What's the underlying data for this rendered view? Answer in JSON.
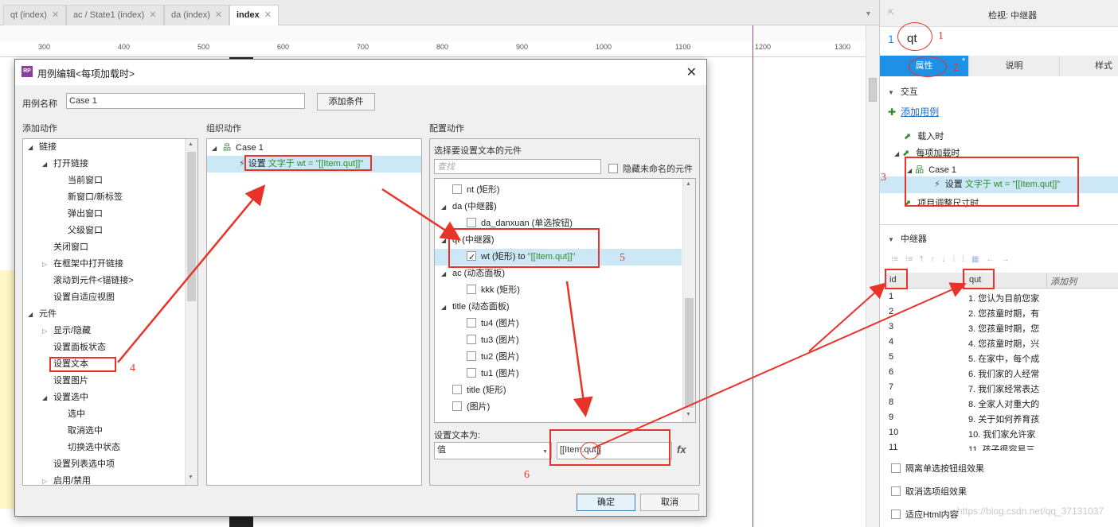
{
  "tabs": [
    {
      "label": "qt (index)"
    },
    {
      "label": "ac / State1 (index)"
    },
    {
      "label": "da (index)"
    },
    {
      "label": "index"
    }
  ],
  "ruler": [
    "300",
    "400",
    "500",
    "600",
    "700",
    "800",
    "900",
    "1000",
    "1100",
    "1200",
    "1300"
  ],
  "dialog": {
    "title": "用例编辑<每项加载时>",
    "case_name_label": "用例名称",
    "case_name_value": "Case 1",
    "add_condition": "添加条件",
    "col1_title": "添加动作",
    "col2_title": "组织动作",
    "col3_title": "配置动作",
    "actions": [
      {
        "label": "链接",
        "level": 0,
        "arrow": "down"
      },
      {
        "label": "打开链接",
        "level": 1,
        "arrow": "down"
      },
      {
        "label": "当前窗口",
        "level": 2,
        "arrow": ""
      },
      {
        "label": "新窗口/新标签",
        "level": 2,
        "arrow": ""
      },
      {
        "label": "弹出窗口",
        "level": 2,
        "arrow": ""
      },
      {
        "label": "父级窗口",
        "level": 2,
        "arrow": ""
      },
      {
        "label": "关闭窗口",
        "level": 1,
        "arrow": ""
      },
      {
        "label": "在框架中打开链接",
        "level": 1,
        "arrow": "right"
      },
      {
        "label": "滚动到元件<锚链接>",
        "level": 1,
        "arrow": ""
      },
      {
        "label": "设置自适应视图",
        "level": 1,
        "arrow": ""
      },
      {
        "label": "元件",
        "level": 0,
        "arrow": "down"
      },
      {
        "label": "显示/隐藏",
        "level": 1,
        "arrow": "right"
      },
      {
        "label": "设置面板状态",
        "level": 1,
        "arrow": ""
      },
      {
        "label": "设置文本",
        "level": 1,
        "arrow": ""
      },
      {
        "label": "设置图片",
        "level": 1,
        "arrow": ""
      },
      {
        "label": "设置选中",
        "level": 1,
        "arrow": "down"
      },
      {
        "label": "选中",
        "level": 2,
        "arrow": ""
      },
      {
        "label": "取消选中",
        "level": 2,
        "arrow": ""
      },
      {
        "label": "切换选中状态",
        "level": 2,
        "arrow": ""
      },
      {
        "label": "设置列表选中项",
        "level": 1,
        "arrow": ""
      },
      {
        "label": "启用/禁用",
        "level": 1,
        "arrow": "right"
      }
    ],
    "organize": {
      "case": "Case 1",
      "action_prefix": "设置 ",
      "action_green": "文字于 wt = \"[[Item.qut]]\""
    },
    "config": {
      "select_label": "选择要设置文本的元件",
      "search_placeholder": "查找",
      "hide_unnamed": "隐藏未命名的元件",
      "widgets": [
        {
          "label": "nt (矩形)",
          "type": "cb",
          "indent": 1
        },
        {
          "label": "da (中继器)",
          "type": "group",
          "indent": 0
        },
        {
          "label": "da_danxuan (单选按钮)",
          "type": "cb",
          "indent": 2
        },
        {
          "label": "qt (中继器)",
          "type": "group",
          "indent": 0
        },
        {
          "label": "wt (矩形) to ",
          "type": "cb-checked",
          "indent": 2,
          "green": "\"[[Item.qut]]\""
        },
        {
          "label": "ac (动态面板)",
          "type": "group",
          "indent": 0
        },
        {
          "label": "kkk (矩形)",
          "type": "cb",
          "indent": 2
        },
        {
          "label": "title (动态面板)",
          "type": "group",
          "indent": 0
        },
        {
          "label": "tu4 (图片)",
          "type": "cb",
          "indent": 2
        },
        {
          "label": "tu3 (图片)",
          "type": "cb",
          "indent": 2
        },
        {
          "label": "tu2 (图片)",
          "type": "cb",
          "indent": 2
        },
        {
          "label": "tu1 (图片)",
          "type": "cb",
          "indent": 2
        },
        {
          "label": "title (矩形)",
          "type": "cb",
          "indent": 1
        },
        {
          "label": "(图片)",
          "type": "cb",
          "indent": 1
        }
      ],
      "set_text_label": "设置文本为:",
      "mode_value": "值",
      "text_value": "[[Item.qut]]",
      "fx": "fx"
    },
    "ok": "确定",
    "cancel": "取消"
  },
  "annotations": [
    "1",
    "2",
    "3",
    "4",
    "5",
    "6"
  ],
  "inspector": {
    "header": "检视: 中继器",
    "name_index": "1",
    "name": "qt",
    "tabs": [
      "属性",
      "说明",
      "样式"
    ],
    "tab_star": "*",
    "interaction_title": "交互",
    "add_case": "添加用例",
    "events": [
      "载入时",
      "每项加载时"
    ],
    "case": "Case 1",
    "action_prefix": "设置 ",
    "action_green": "文字于 wt = \"[[Item.qut]]\"",
    "event_resize": "项目调整尺寸时",
    "repeater_title": "中继器",
    "columns": [
      "id",
      "qut",
      "添加列"
    ],
    "rows": [
      [
        "1",
        "1. 您认为目前您家"
      ],
      [
        "2",
        "2. 您孩童时期，有"
      ],
      [
        "3",
        "3. 您孩童时期，您"
      ],
      [
        "4",
        "4. 您孩童时期，兴"
      ],
      [
        "5",
        "5. 在家中，每个成"
      ],
      [
        "6",
        "6. 我们家的人经常"
      ],
      [
        "7",
        "7. 我们家经常表达"
      ],
      [
        "8",
        "8. 全家人对重大的"
      ],
      [
        "9",
        "9. 关于如何养育孩"
      ],
      [
        "10",
        "10. 我们家允许家"
      ],
      [
        "11",
        "11. 孩子很容易三"
      ]
    ],
    "options": [
      "隔离单选按钮组效果",
      "取消选项组效果",
      "适应Html内容"
    ]
  },
  "watermark": "https://blog.csdn.net/qq_37131037"
}
